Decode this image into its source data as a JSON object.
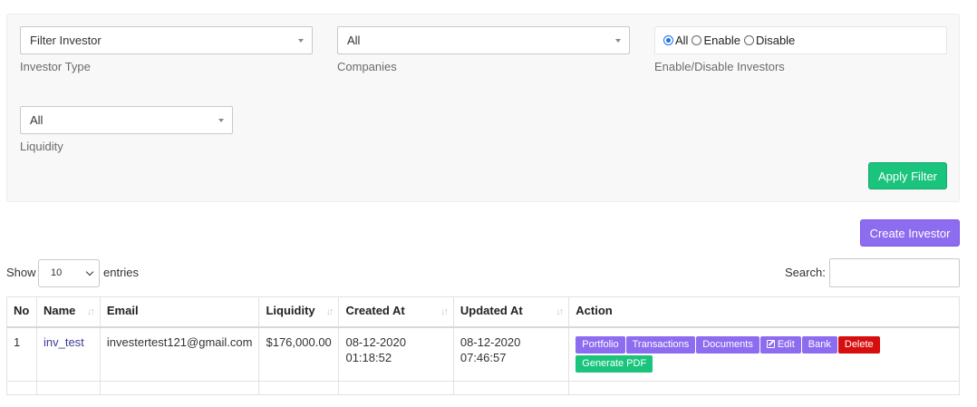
{
  "filters": {
    "investor_type": {
      "value": "Filter Investor",
      "label": "Investor Type"
    },
    "companies": {
      "value": "All",
      "label": "Companies"
    },
    "enable_disable": {
      "label": "Enable/Disable Investors",
      "options": [
        "All",
        "Enable",
        "Disable"
      ],
      "selected": "All"
    },
    "liquidity": {
      "value": "All",
      "label": "Liquidity"
    },
    "apply_label": "Apply Filter"
  },
  "create_investor_label": "Create Investor",
  "table_controls": {
    "show_label": "Show",
    "page_length": "10",
    "entries_label": "entries",
    "search_label": "Search:"
  },
  "table": {
    "columns": [
      "No",
      "Name",
      "Email",
      "Liquidity",
      "Created At",
      "Updated At",
      "Action"
    ],
    "rows": [
      {
        "no": "1",
        "name": "inv_test",
        "email": "investertest121@gmail.com",
        "liquidity": "$176,000.00",
        "created_date": "08-12-2020",
        "created_time": "01:18:52",
        "updated_date": "08-12-2020",
        "updated_time": "07:46:57",
        "actions": {
          "portfolio": "Portfolio",
          "transactions": "Transactions",
          "documents": "Documents",
          "edit": "Edit",
          "bank": "Bank",
          "delete": "Delete",
          "generate_pdf": "Generate PDF"
        }
      }
    ]
  },
  "colors": {
    "accent_purple": "#8d6cf0",
    "accent_green": "#1bc47d",
    "danger_red": "#d60e0e"
  }
}
